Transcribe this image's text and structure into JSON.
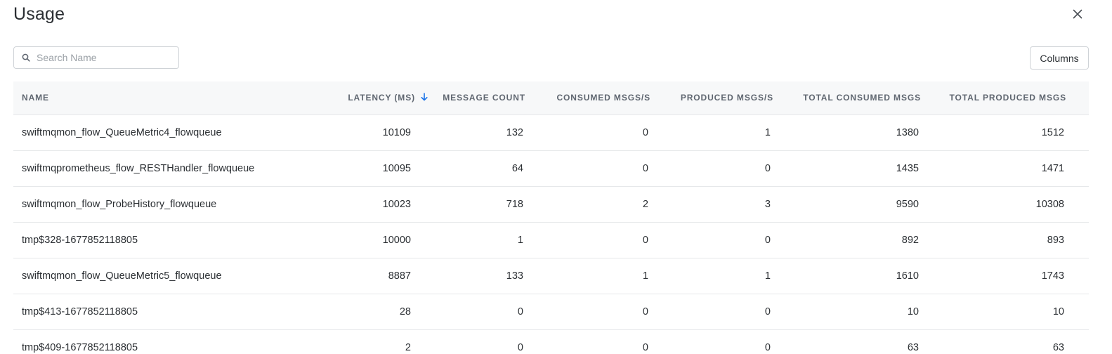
{
  "dialog": {
    "title": "Usage",
    "close_icon": "close-icon"
  },
  "toolbar": {
    "search_placeholder": "Search Name",
    "search_value": "",
    "search_icon": "search-icon",
    "columns_label": "Columns"
  },
  "table": {
    "headers": {
      "name": "NAME",
      "latency": "LATENCY (MS)",
      "message_count": "MESSAGE COUNT",
      "consumed_rate": "CONSUMED MSGS/S",
      "produced_rate": "PRODUCED MSGS/S",
      "total_consumed": "TOTAL CONSUMED MSGS",
      "total_produced": "TOTAL PRODUCED MSGS"
    },
    "sort": {
      "column": "latency",
      "direction": "descending",
      "icon": "arrow-down-icon",
      "color": "#1a73e8"
    },
    "rows": [
      {
        "name": "swiftmqmon_flow_QueueMetric4_flowqueue",
        "latency": "10109",
        "message_count": "132",
        "consumed_rate": "0",
        "produced_rate": "1",
        "total_consumed": "1380",
        "total_produced": "1512"
      },
      {
        "name": "swiftmqprometheus_flow_RESTHandler_flowqueue",
        "latency": "10095",
        "message_count": "64",
        "consumed_rate": "0",
        "produced_rate": "0",
        "total_consumed": "1435",
        "total_produced": "1471"
      },
      {
        "name": "swiftmqmon_flow_ProbeHistory_flowqueue",
        "latency": "10023",
        "message_count": "718",
        "consumed_rate": "2",
        "produced_rate": "3",
        "total_consumed": "9590",
        "total_produced": "10308"
      },
      {
        "name": "tmp$328-1677852118805",
        "latency": "10000",
        "message_count": "1",
        "consumed_rate": "0",
        "produced_rate": "0",
        "total_consumed": "892",
        "total_produced": "893"
      },
      {
        "name": "swiftmqmon_flow_QueueMetric5_flowqueue",
        "latency": "8887",
        "message_count": "133",
        "consumed_rate": "1",
        "produced_rate": "1",
        "total_consumed": "1610",
        "total_produced": "1743"
      },
      {
        "name": "tmp$413-1677852118805",
        "latency": "28",
        "message_count": "0",
        "consumed_rate": "0",
        "produced_rate": "0",
        "total_consumed": "10",
        "total_produced": "10"
      },
      {
        "name": "tmp$409-1677852118805",
        "latency": "2",
        "message_count": "0",
        "consumed_rate": "0",
        "produced_rate": "0",
        "total_consumed": "63",
        "total_produced": "63"
      }
    ]
  }
}
